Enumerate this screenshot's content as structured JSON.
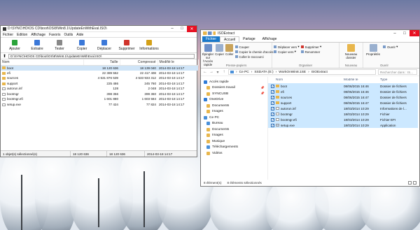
{
  "colors": {
    "accent": "#1979ca",
    "selection": "#cce8ff",
    "folder": "#e8b64c"
  },
  "zip": {
    "title": "D:\\SYNC\\HD\\OS CD\\boot\\OS\\8\\Win8.1\\UpdateEnWithEval.ISO\\",
    "menu": [
      "Fichier",
      "Edition",
      "Affichage",
      "Favoris",
      "Outils",
      "Aide"
    ],
    "tools": [
      {
        "label": "Ajouter",
        "icon": "add-icon",
        "color": "#2aa33a"
      },
      {
        "label": "Extraire",
        "icon": "extract-icon",
        "color": "#3b78d8"
      },
      {
        "label": "Tester",
        "icon": "test-icon",
        "color": "#888888"
      },
      {
        "label": "Copier",
        "icon": "copy-icon",
        "color": "#3b78d8"
      },
      {
        "label": "Déplacer",
        "icon": "move-icon",
        "color": "#3b78d8"
      },
      {
        "label": "Supprimer",
        "icon": "delete-icon",
        "color": "#d0342c"
      },
      {
        "label": "Informations",
        "icon": "info-icon",
        "color": "#d4a017"
      }
    ],
    "address": "D:\\SYNC\\HD\\OS CD\\boot\\OS\\8\\Win8.1\\UpdateEnWithEval.ISO\\",
    "columns": {
      "name": "Nom",
      "size": "Taille",
      "packed": "Compressé",
      "modified": "Modifié le"
    },
    "rows": [
      {
        "name": "boot",
        "type": "folder",
        "size": "18 120 636",
        "packed": "18 139 040",
        "modified": "2014-03-18 14:17",
        "selected": true
      },
      {
        "name": "efi",
        "type": "folder",
        "size": "22 389 552",
        "packed": "22 417 408",
        "modified": "2014-03-18 14:17",
        "selected": false
      },
      {
        "name": "sources",
        "type": "folder",
        "size": "4 531 876 539",
        "packed": "4 533 933 312",
        "modified": "2014-03-18 14:17",
        "selected": false
      },
      {
        "name": "support",
        "type": "folder",
        "size": "225 486",
        "packed": "245 760",
        "modified": "2014-03-18 14:17",
        "selected": false
      },
      {
        "name": "autorun.inf",
        "type": "file",
        "size": "128",
        "packed": "2 048",
        "modified": "2014-03-18 14:17",
        "selected": false
      },
      {
        "name": "bootmgr",
        "type": "file",
        "size": "398 356",
        "packed": "399 360",
        "modified": "2014-03-18 14:17",
        "selected": false
      },
      {
        "name": "bootmgr.efi",
        "type": "file",
        "size": "1 601 880",
        "packed": "1 603 584",
        "modified": "2014-03-18 14:17",
        "selected": false
      },
      {
        "name": "setup.exe",
        "type": "file",
        "size": "77 424",
        "packed": "77 824",
        "modified": "2014-03-18 14:17",
        "selected": false
      }
    ],
    "status": [
      "1 objet(s) sélectionné(s)",
      "18 120 636",
      "18 120 636",
      "2014-03-18 14:17"
    ]
  },
  "explorer": {
    "title": "ISOExtract",
    "tabs": [
      "Fichier",
      "Accueil",
      "Partage",
      "Affichage"
    ],
    "ribbon": {
      "pin": "Épingler sur l'Accès rapide",
      "copy": "Copier",
      "paste": "Coller",
      "cut": "Couper",
      "copy_path": "Copier le chemin d'accès",
      "paste_shortcut": "Coller le raccourci",
      "clipboard_group": "Presse-papiers",
      "move_to": "Déplacer vers",
      "copy_to": "Copier vers",
      "delete": "Supprimer",
      "rename": "Renommer",
      "organize_group": "Organiser",
      "new_folder": "Nouveau dossier",
      "new_group": "Nouveau",
      "properties": "Propriétés",
      "open": "Ouvrir",
      "open_group": "Ouvrir"
    },
    "breadcrumb": [
      "Ce PC",
      "SSDATA (E:)",
      "WorkOnWin8.1SE",
      "ISOExtract"
    ],
    "search_placeholder": "Rechercher dans : IS...",
    "nav": [
      {
        "label": "Accès rapide",
        "icon": "star-icon",
        "color": "#2f7bd6",
        "pinned": false
      },
      {
        "label": "Dossiers travail",
        "icon": "folder-icon",
        "color": "#e8b64c",
        "pinned": true
      },
      {
        "label": "SYNCUSB",
        "icon": "folder-icon",
        "color": "#e8b64c",
        "pinned": true
      },
      {
        "label": "OneDrive",
        "icon": "cloud-icon",
        "color": "#2f7bd6",
        "pinned": false
      },
      {
        "label": "Documents",
        "icon": "folder-icon",
        "color": "#e8b64c",
        "pinned": false
      },
      {
        "label": "Images",
        "icon": "folder-icon",
        "color": "#e8b64c",
        "pinned": false
      },
      {
        "label": "Ce PC",
        "icon": "computer-icon",
        "color": "#4a90d9",
        "pinned": false
      },
      {
        "label": "Bureau",
        "icon": "desktop-icon",
        "color": "#4a90d9",
        "pinned": false
      },
      {
        "label": "Documents",
        "icon": "folder-icon",
        "color": "#e8b64c",
        "pinned": false
      },
      {
        "label": "Images",
        "icon": "folder-icon",
        "color": "#e8b64c",
        "pinned": false
      },
      {
        "label": "Musique",
        "icon": "music-icon",
        "color": "#e8b64c",
        "pinned": false
      },
      {
        "label": "Téléchargements",
        "icon": "download-icon",
        "color": "#4a90d9",
        "pinned": false
      },
      {
        "label": "Vidéos",
        "icon": "video-icon",
        "color": "#e8b64c",
        "pinned": false
      }
    ],
    "columns": {
      "name": "Nom",
      "modified": "Modifié le",
      "type": "Type"
    },
    "rows": [
      {
        "name": "boot",
        "type_kind": "folder",
        "modified": "08/06/2015 16:46",
        "type": "Dossier de fichiers"
      },
      {
        "name": "efi",
        "type_kind": "folder",
        "modified": "08/06/2015 16:46",
        "type": "Dossier de fichiers"
      },
      {
        "name": "sources",
        "type_kind": "folder",
        "modified": "08/06/2015 16:47",
        "type": "Dossier de fichiers"
      },
      {
        "name": "support",
        "type_kind": "folder",
        "modified": "08/06/2015 16:47",
        "type": "Dossier de fichiers"
      },
      {
        "name": "autorun.inf",
        "type_kind": "file",
        "modified": "18/03/2014 10:29",
        "type": "Informations de l..."
      },
      {
        "name": "bootmgr",
        "type_kind": "file",
        "modified": "18/03/2014 10:29",
        "type": "Fichier"
      },
      {
        "name": "bootmgr.efi",
        "type_kind": "file",
        "modified": "18/03/2014 10:29",
        "type": "Fichier EFI"
      },
      {
        "name": "setup.exe",
        "type_kind": "file",
        "modified": "18/03/2014 10:29",
        "type": "Application"
      }
    ],
    "status_count": "8 élément(s)",
    "status_selected": "8 éléments sélectionnés"
  }
}
